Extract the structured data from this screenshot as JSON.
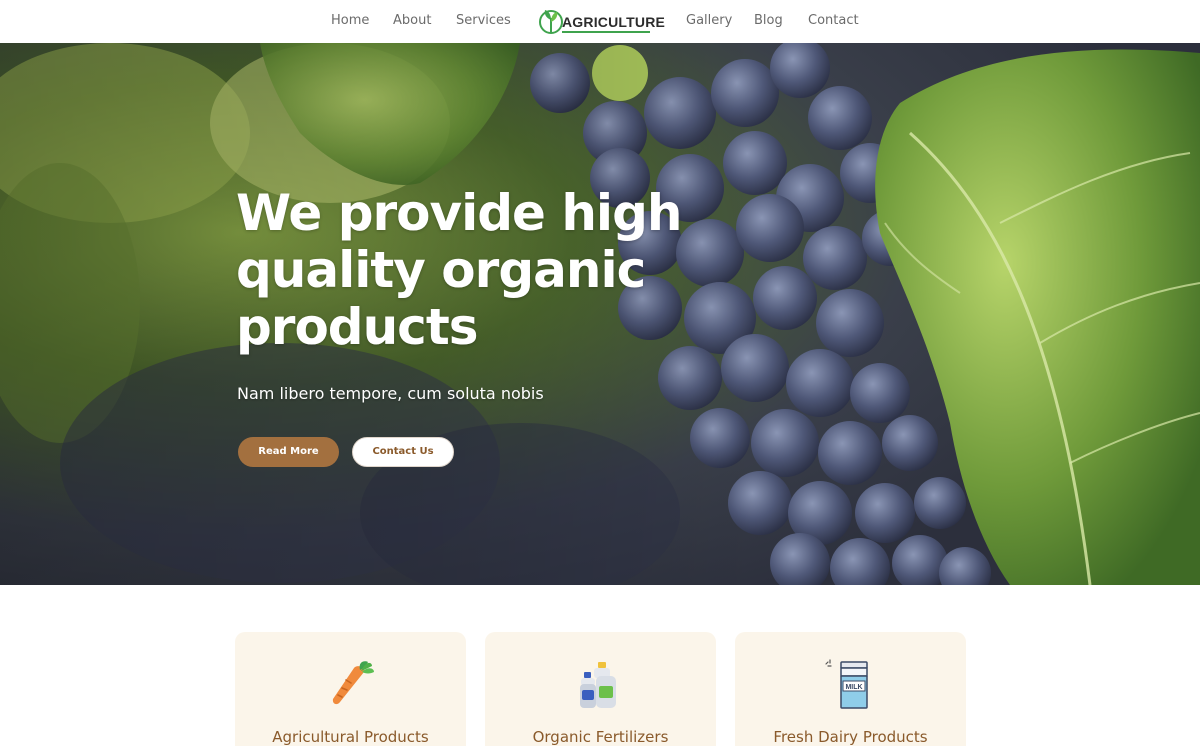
{
  "nav": {
    "left_links": [
      "Home",
      "About",
      "Services"
    ],
    "right_links": [
      "Gallery",
      "Blog",
      "Contact"
    ],
    "logo_text": "AGRICULTURE",
    "logo_icon": "sprout-icon"
  },
  "hero": {
    "title": "We provide high quality organic products",
    "subtitle": "Nam libero tempore, cum soluta nobis",
    "primary_button": "Read More",
    "secondary_button": "Contact Us",
    "background": "grapes-photo"
  },
  "cards": [
    {
      "title": "Agricultural Products",
      "icon": "carrot-icon"
    },
    {
      "title": "Organic Fertilizers",
      "icon": "fertilizer-bottles-icon"
    },
    {
      "title": "Fresh Dairy Products",
      "icon": "milk-carton-icon",
      "icon_text": "MILK"
    }
  ],
  "colors": {
    "accent": "#a3703f",
    "card_bg": "#fbf5ea",
    "card_title": "#8a5a2b",
    "logo_green": "#3fa34d",
    "nav_text": "#6b6b6b"
  }
}
